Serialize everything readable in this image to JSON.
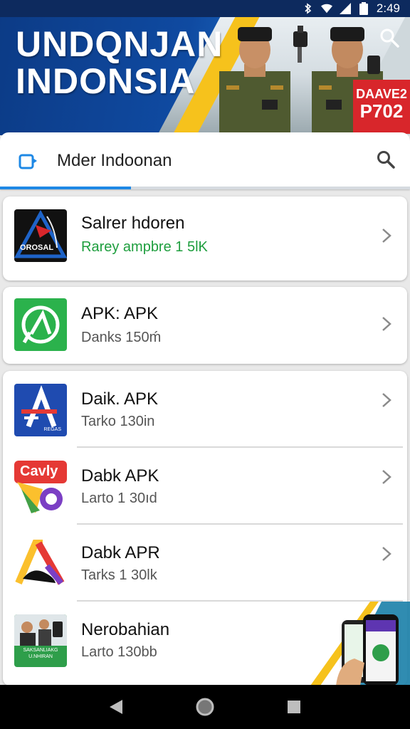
{
  "status_bar": {
    "time": "2:49"
  },
  "banner": {
    "title_line1": "UNDQNJAN",
    "title_line2": "INDONSIA",
    "badge_line1": "DAAVE2",
    "badge_line2": "P702"
  },
  "search": {
    "label": "Mder Indoonan",
    "progress": 0.32
  },
  "items": [
    {
      "name": "Salrer hdoren",
      "sub": "Rarey ampbre 1 5ƖK",
      "icon": "triangle-app-icon",
      "thumb_text": "OROSAL"
    },
    {
      "name": "APK: APK",
      "sub": "Danks 150ḿ",
      "icon": "green-a-app-icon"
    },
    {
      "name": "Daik. APK",
      "sub": "Tarko 130in",
      "icon": "blue-a-app-icon",
      "thumb_text": "REGAS"
    },
    {
      "name": "Dabk APK",
      "sub": "Larto 1 30ıd",
      "icon": "colorful-app-icon",
      "thumb_text": "Cavly"
    },
    {
      "name": "Dabk APR",
      "sub": "Tarks 1 30lk",
      "icon": "rainbow-a-app-icon"
    },
    {
      "name": "Nerobahian",
      "sub": "Larto 130bb",
      "icon": "people-app-icon",
      "thumb_text": "SAKSANLIAKG\nU.NHIRAN"
    }
  ],
  "colors": {
    "banner_blue": "#0f4aa1",
    "accent_yellow": "#f6c21c",
    "badge_red": "#d8262b",
    "green_sub": "#1e9e3e",
    "progress_blue": "#1e88e5"
  }
}
